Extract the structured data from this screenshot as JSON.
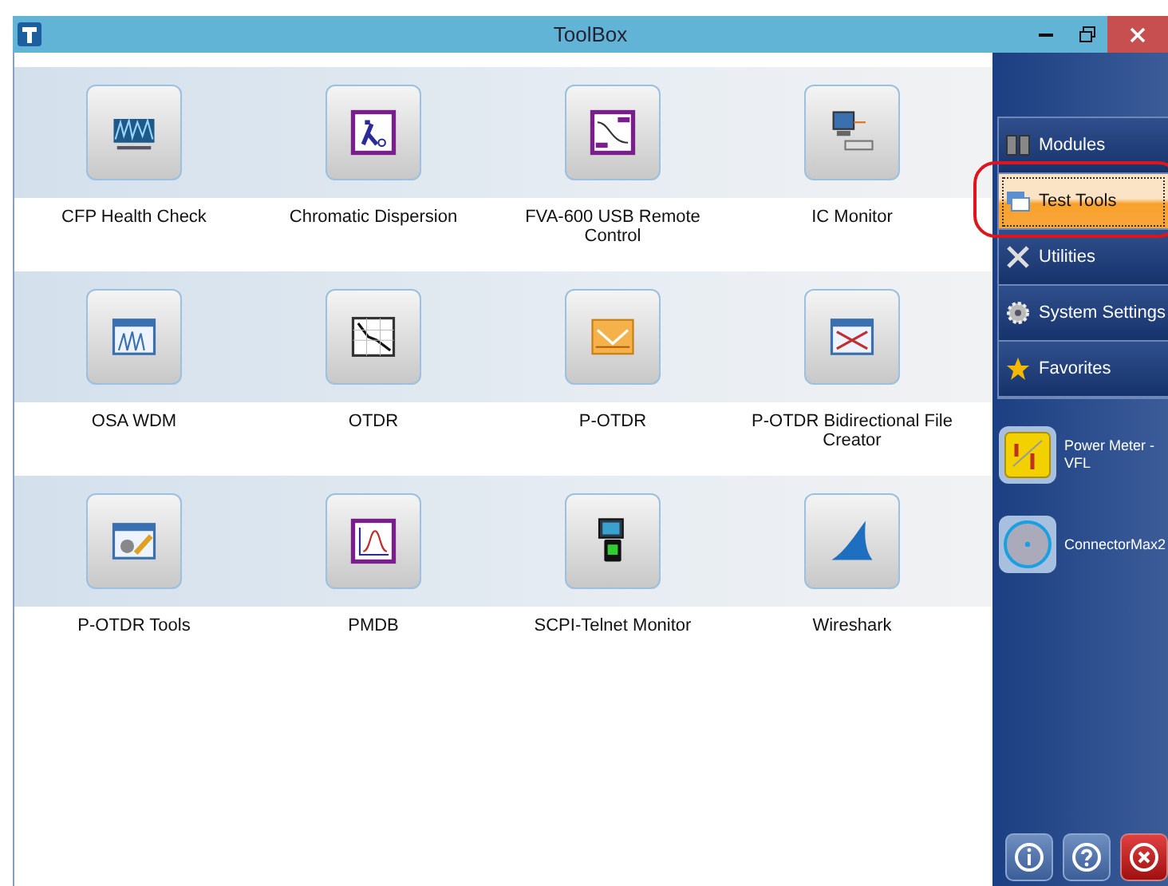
{
  "window": {
    "title": "ToolBox"
  },
  "tools": [
    {
      "label": "CFP Health Check",
      "kind": "cfp"
    },
    {
      "label": "Chromatic Dispersion",
      "kind": "lambda"
    },
    {
      "label": "FVA-600 USB Remote Control",
      "kind": "fva"
    },
    {
      "label": "IC Monitor",
      "kind": "scpi"
    },
    {
      "label": "OSA WDM",
      "kind": "osa"
    },
    {
      "label": "OTDR",
      "kind": "otdr"
    },
    {
      "label": "P-OTDR",
      "kind": "potdr"
    },
    {
      "label": "P-OTDR Bidirectional File Creator",
      "kind": "bidir"
    },
    {
      "label": "P-OTDR Tools",
      "kind": "tools"
    },
    {
      "label": "PMDB",
      "kind": "pmdb"
    },
    {
      "label": "SCPI-Telnet Monitor",
      "kind": "telnet"
    },
    {
      "label": "Wireshark",
      "kind": "shark"
    }
  ],
  "nav": [
    {
      "label": "Modules",
      "kind": "modules",
      "selected": false
    },
    {
      "label": "Test Tools",
      "kind": "testtools",
      "selected": true
    },
    {
      "label": "Utilities",
      "kind": "utilities",
      "selected": false
    },
    {
      "label": "System Settings",
      "kind": "settings",
      "selected": false
    },
    {
      "label": "Favorites",
      "kind": "favorites",
      "selected": false
    }
  ],
  "quick_launch": [
    {
      "label": "Power Meter - VFL",
      "kind": "power"
    },
    {
      "label": "ConnectorMax2",
      "kind": "connector"
    }
  ],
  "footer_buttons": [
    {
      "kind": "info"
    },
    {
      "kind": "help"
    },
    {
      "kind": "close"
    }
  ]
}
